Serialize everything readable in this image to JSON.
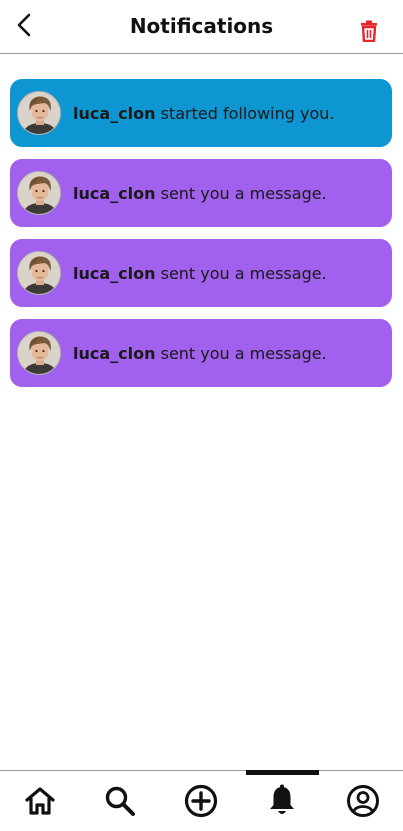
{
  "header": {
    "title": "Notifications",
    "back_icon": "chevron-left-icon",
    "delete_icon": "trash-icon",
    "delete_icon_color": "#e5252a"
  },
  "notifications": [
    {
      "username": "luca_clon",
      "message": "started following you.",
      "color": "#0e96d2",
      "type": "follow"
    },
    {
      "username": "luca_clon",
      "message": "sent you a message.",
      "color": "#a160ee",
      "type": "message"
    },
    {
      "username": "luca_clon",
      "message": "sent you a message.",
      "color": "#a160ee",
      "type": "message"
    },
    {
      "username": "luca_clon",
      "message": "sent you a message.",
      "color": "#a160ee",
      "type": "message"
    }
  ],
  "bottom_nav": {
    "items": [
      {
        "icon": "home-icon",
        "active": false
      },
      {
        "icon": "search-icon",
        "active": false
      },
      {
        "icon": "add-circle-icon",
        "active": false
      },
      {
        "icon": "bell-icon",
        "active": true
      },
      {
        "icon": "account-circle-icon",
        "active": false
      }
    ]
  }
}
